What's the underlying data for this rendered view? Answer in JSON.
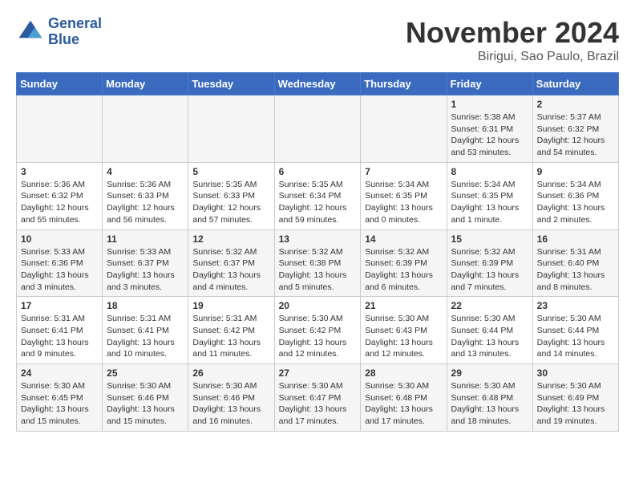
{
  "header": {
    "logo_line1": "General",
    "logo_line2": "Blue",
    "month_title": "November 2024",
    "location": "Birigui, Sao Paulo, Brazil"
  },
  "days_of_week": [
    "Sunday",
    "Monday",
    "Tuesday",
    "Wednesday",
    "Thursday",
    "Friday",
    "Saturday"
  ],
  "weeks": [
    [
      {
        "num": "",
        "info": ""
      },
      {
        "num": "",
        "info": ""
      },
      {
        "num": "",
        "info": ""
      },
      {
        "num": "",
        "info": ""
      },
      {
        "num": "",
        "info": ""
      },
      {
        "num": "1",
        "info": "Sunrise: 5:38 AM\nSunset: 6:31 PM\nDaylight: 12 hours and 53 minutes."
      },
      {
        "num": "2",
        "info": "Sunrise: 5:37 AM\nSunset: 6:32 PM\nDaylight: 12 hours and 54 minutes."
      }
    ],
    [
      {
        "num": "3",
        "info": "Sunrise: 5:36 AM\nSunset: 6:32 PM\nDaylight: 12 hours and 55 minutes."
      },
      {
        "num": "4",
        "info": "Sunrise: 5:36 AM\nSunset: 6:33 PM\nDaylight: 12 hours and 56 minutes."
      },
      {
        "num": "5",
        "info": "Sunrise: 5:35 AM\nSunset: 6:33 PM\nDaylight: 12 hours and 57 minutes."
      },
      {
        "num": "6",
        "info": "Sunrise: 5:35 AM\nSunset: 6:34 PM\nDaylight: 12 hours and 59 minutes."
      },
      {
        "num": "7",
        "info": "Sunrise: 5:34 AM\nSunset: 6:35 PM\nDaylight: 13 hours and 0 minutes."
      },
      {
        "num": "8",
        "info": "Sunrise: 5:34 AM\nSunset: 6:35 PM\nDaylight: 13 hours and 1 minute."
      },
      {
        "num": "9",
        "info": "Sunrise: 5:34 AM\nSunset: 6:36 PM\nDaylight: 13 hours and 2 minutes."
      }
    ],
    [
      {
        "num": "10",
        "info": "Sunrise: 5:33 AM\nSunset: 6:36 PM\nDaylight: 13 hours and 3 minutes."
      },
      {
        "num": "11",
        "info": "Sunrise: 5:33 AM\nSunset: 6:37 PM\nDaylight: 13 hours and 3 minutes."
      },
      {
        "num": "12",
        "info": "Sunrise: 5:32 AM\nSunset: 6:37 PM\nDaylight: 13 hours and 4 minutes."
      },
      {
        "num": "13",
        "info": "Sunrise: 5:32 AM\nSunset: 6:38 PM\nDaylight: 13 hours and 5 minutes."
      },
      {
        "num": "14",
        "info": "Sunrise: 5:32 AM\nSunset: 6:39 PM\nDaylight: 13 hours and 6 minutes."
      },
      {
        "num": "15",
        "info": "Sunrise: 5:32 AM\nSunset: 6:39 PM\nDaylight: 13 hours and 7 minutes."
      },
      {
        "num": "16",
        "info": "Sunrise: 5:31 AM\nSunset: 6:40 PM\nDaylight: 13 hours and 8 minutes."
      }
    ],
    [
      {
        "num": "17",
        "info": "Sunrise: 5:31 AM\nSunset: 6:41 PM\nDaylight: 13 hours and 9 minutes."
      },
      {
        "num": "18",
        "info": "Sunrise: 5:31 AM\nSunset: 6:41 PM\nDaylight: 13 hours and 10 minutes."
      },
      {
        "num": "19",
        "info": "Sunrise: 5:31 AM\nSunset: 6:42 PM\nDaylight: 13 hours and 11 minutes."
      },
      {
        "num": "20",
        "info": "Sunrise: 5:30 AM\nSunset: 6:42 PM\nDaylight: 13 hours and 12 minutes."
      },
      {
        "num": "21",
        "info": "Sunrise: 5:30 AM\nSunset: 6:43 PM\nDaylight: 13 hours and 12 minutes."
      },
      {
        "num": "22",
        "info": "Sunrise: 5:30 AM\nSunset: 6:44 PM\nDaylight: 13 hours and 13 minutes."
      },
      {
        "num": "23",
        "info": "Sunrise: 5:30 AM\nSunset: 6:44 PM\nDaylight: 13 hours and 14 minutes."
      }
    ],
    [
      {
        "num": "24",
        "info": "Sunrise: 5:30 AM\nSunset: 6:45 PM\nDaylight: 13 hours and 15 minutes."
      },
      {
        "num": "25",
        "info": "Sunrise: 5:30 AM\nSunset: 6:46 PM\nDaylight: 13 hours and 15 minutes."
      },
      {
        "num": "26",
        "info": "Sunrise: 5:30 AM\nSunset: 6:46 PM\nDaylight: 13 hours and 16 minutes."
      },
      {
        "num": "27",
        "info": "Sunrise: 5:30 AM\nSunset: 6:47 PM\nDaylight: 13 hours and 17 minutes."
      },
      {
        "num": "28",
        "info": "Sunrise: 5:30 AM\nSunset: 6:48 PM\nDaylight: 13 hours and 17 minutes."
      },
      {
        "num": "29",
        "info": "Sunrise: 5:30 AM\nSunset: 6:48 PM\nDaylight: 13 hours and 18 minutes."
      },
      {
        "num": "30",
        "info": "Sunrise: 5:30 AM\nSunset: 6:49 PM\nDaylight: 13 hours and 19 minutes."
      }
    ]
  ]
}
